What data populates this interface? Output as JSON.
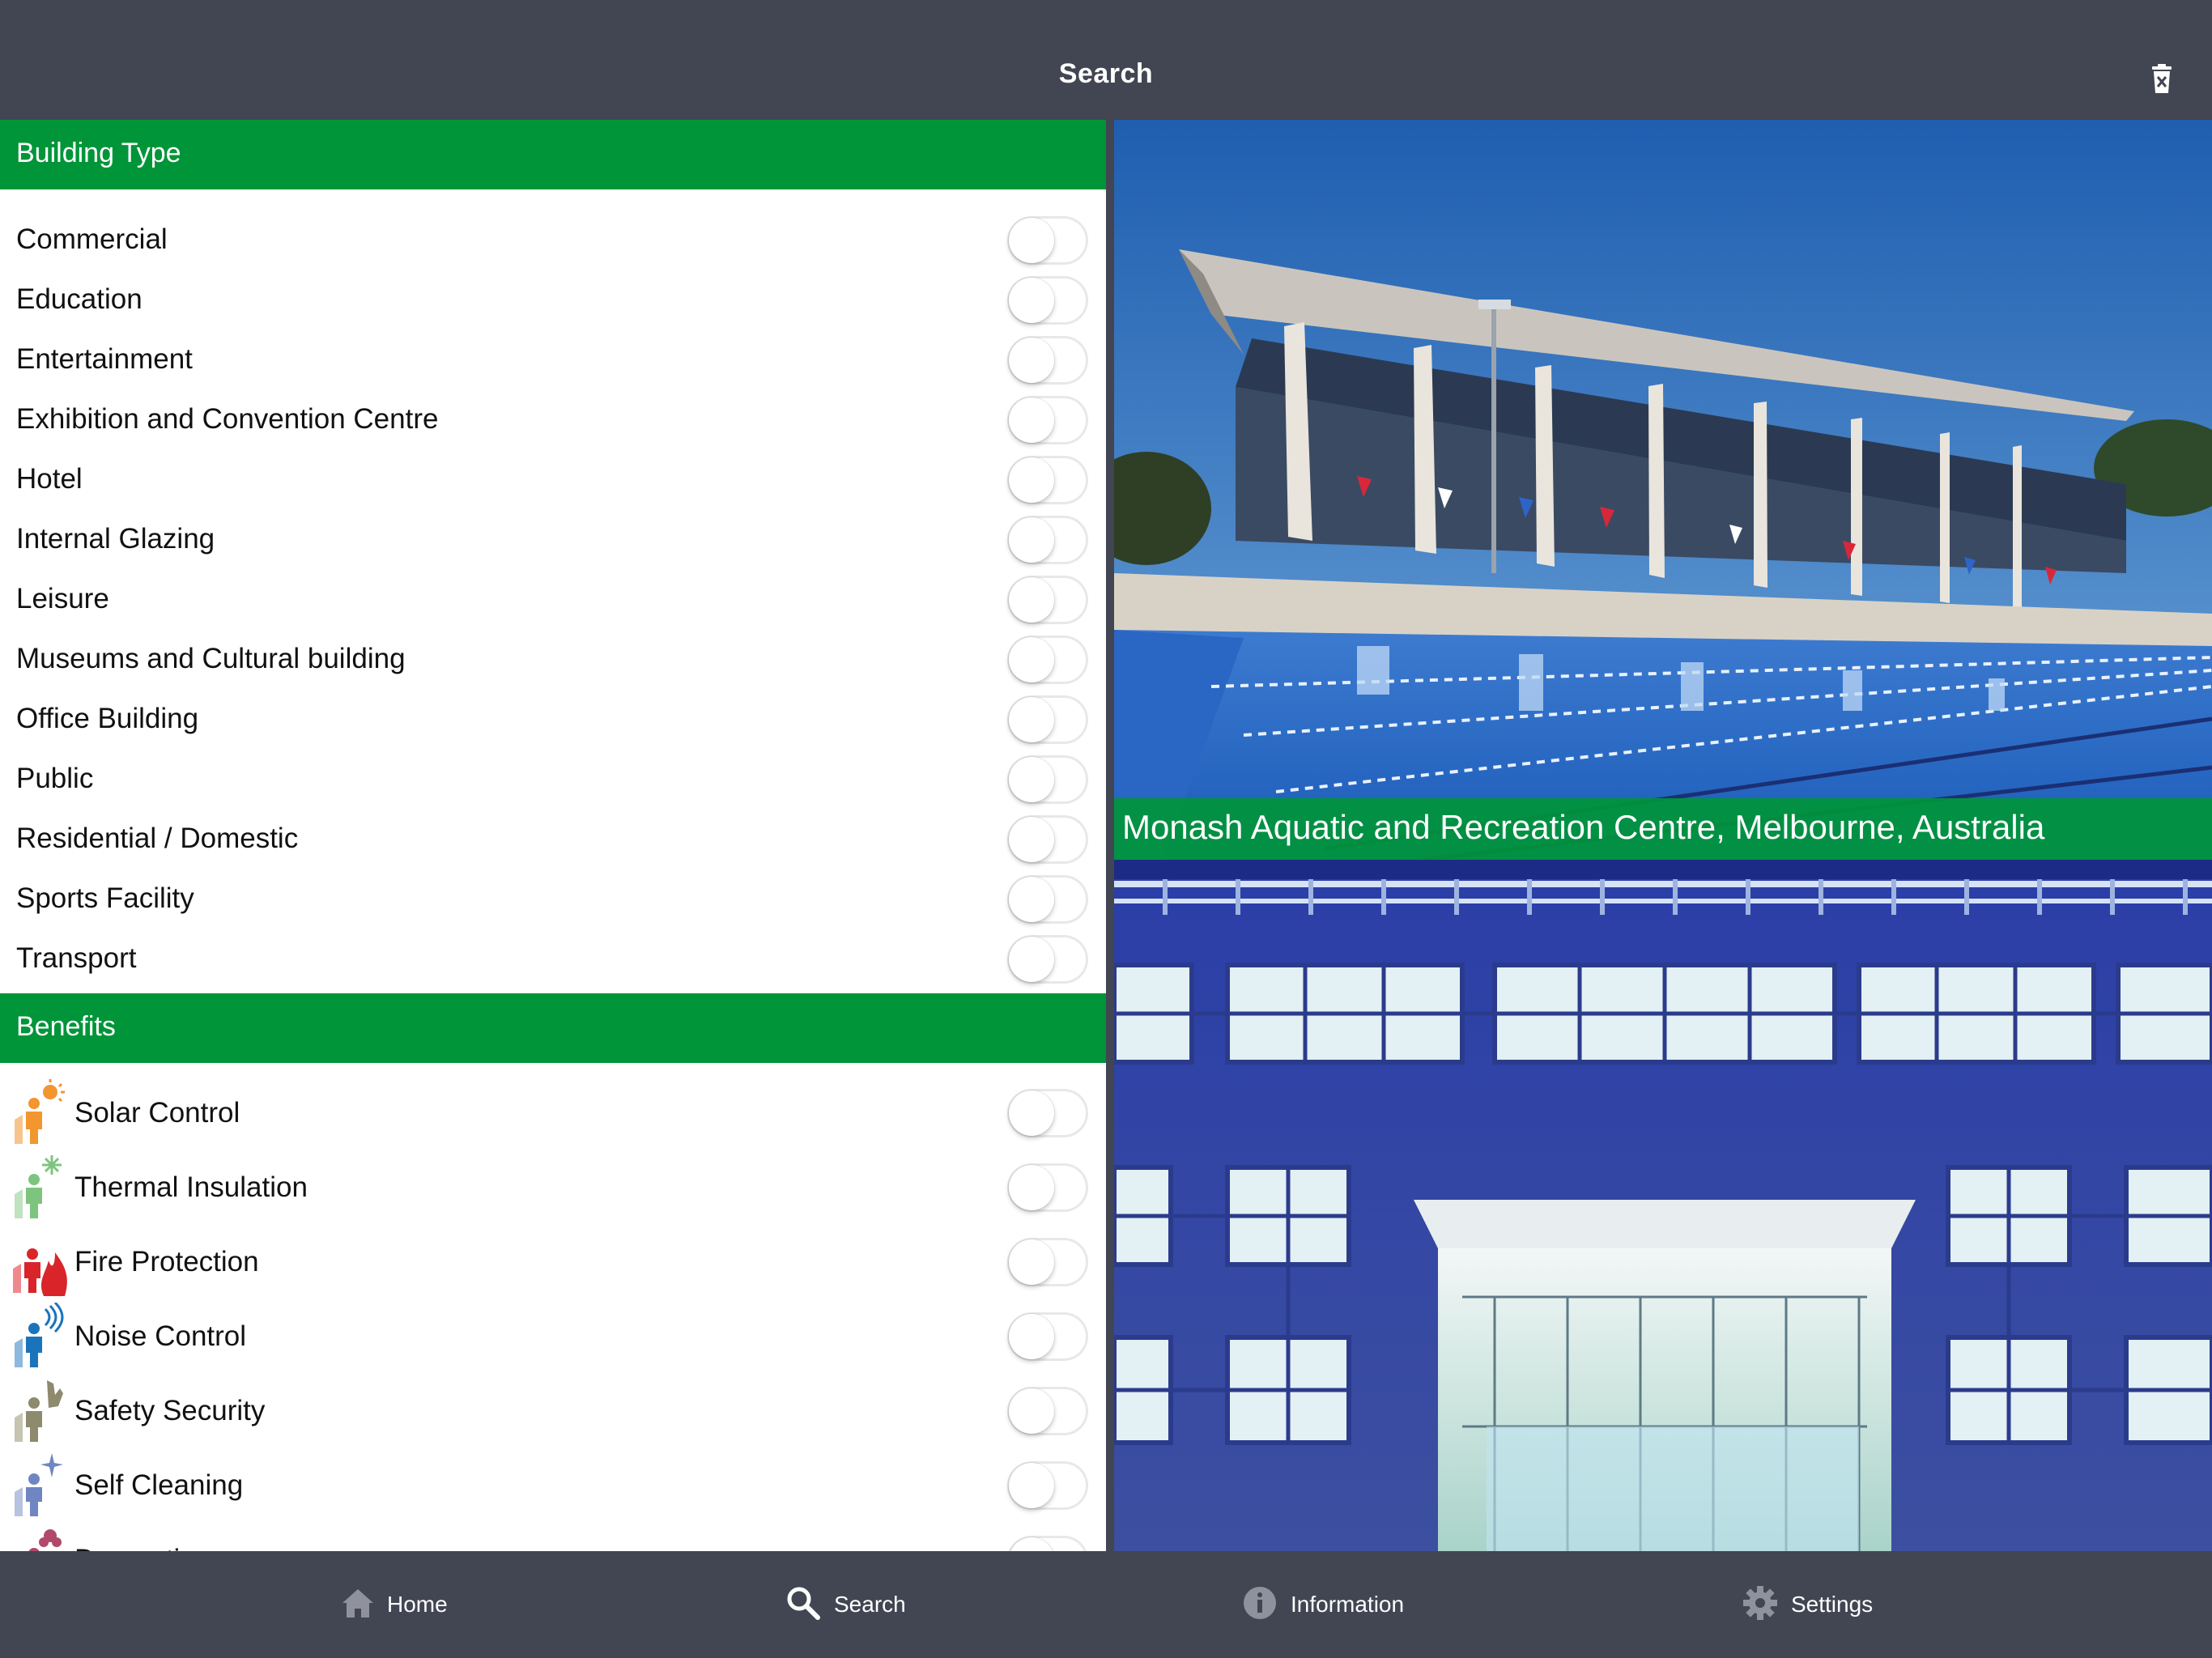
{
  "header": {
    "title": "Search",
    "delete_icon": "trash-icon"
  },
  "building_type": {
    "title": "Building Type",
    "items": [
      {
        "label": "Commercial",
        "on": false
      },
      {
        "label": "Education",
        "on": false
      },
      {
        "label": "Entertainment",
        "on": false
      },
      {
        "label": "Exhibition and Convention Centre",
        "on": false
      },
      {
        "label": "Hotel",
        "on": false
      },
      {
        "label": "Internal Glazing",
        "on": false
      },
      {
        "label": "Leisure",
        "on": false
      },
      {
        "label": "Museums and Cultural building",
        "on": false
      },
      {
        "label": "Office Building",
        "on": false
      },
      {
        "label": "Public",
        "on": false
      },
      {
        "label": "Residential / Domestic",
        "on": false
      },
      {
        "label": "Sports Facility",
        "on": false
      },
      {
        "label": "Transport",
        "on": false
      }
    ]
  },
  "benefits": {
    "title": "Benefits",
    "items": [
      {
        "label": "Solar Control",
        "icon": "solar-control-icon",
        "color": "#F2962F",
        "on": false
      },
      {
        "label": "Thermal Insulation",
        "icon": "thermal-insulation-icon",
        "color": "#7DC57F",
        "on": false
      },
      {
        "label": "Fire Protection",
        "icon": "fire-protection-icon",
        "color": "#D9252A",
        "on": false
      },
      {
        "label": "Noise Control",
        "icon": "noise-control-icon",
        "color": "#1A74BC",
        "on": false
      },
      {
        "label": "Safety Security",
        "icon": "safety-security-icon",
        "color": "#8E8A6E",
        "on": false
      },
      {
        "label": "Self Cleaning",
        "icon": "self-cleaning-icon",
        "color": "#6F86C2",
        "on": false
      },
      {
        "label": "Decoration",
        "icon": "decoration-icon",
        "color": "#B0496A",
        "on": false
      }
    ]
  },
  "gallery": {
    "caption": "Monash Aquatic and Recreation Centre, Melbourne, Australia"
  },
  "tabbar": {
    "tabs": [
      {
        "label": "Home",
        "icon": "home-icon"
      },
      {
        "label": "Search",
        "icon": "search-icon",
        "selected": true
      },
      {
        "label": "Information",
        "icon": "info-icon"
      },
      {
        "label": "Settings",
        "icon": "gear-icon"
      }
    ]
  },
  "colors": {
    "nav_bar": "#424552",
    "section_header": "#009539",
    "caption_bar": "#009539"
  }
}
